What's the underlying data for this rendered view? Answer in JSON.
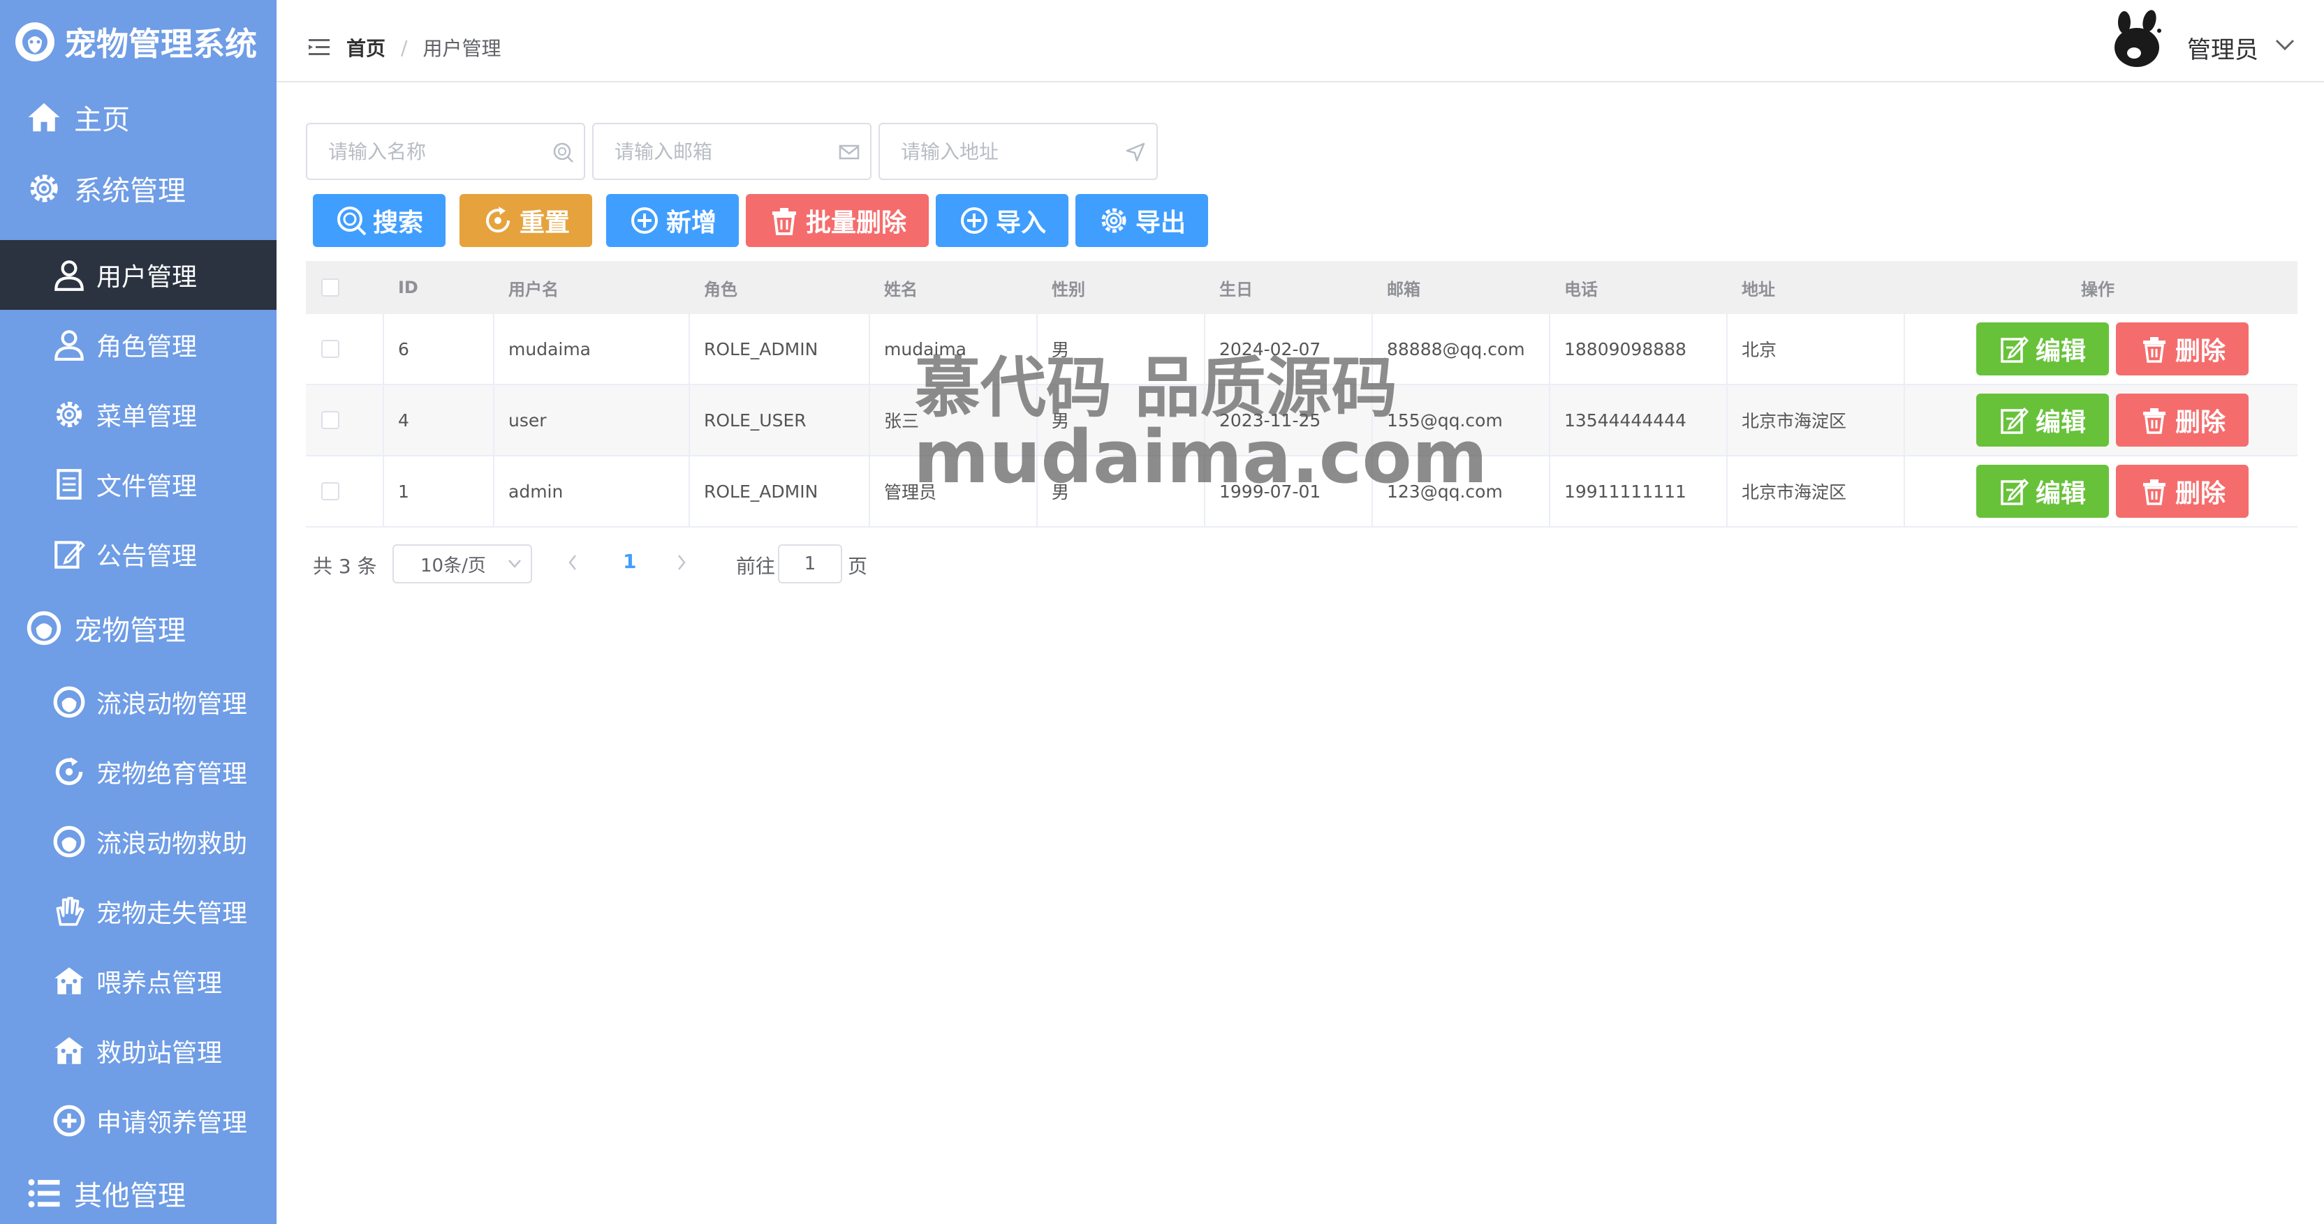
{
  "app": {
    "title": "宠物管理系统"
  },
  "sidebar": {
    "items": [
      {
        "label": "主页",
        "icon": "home-icon"
      },
      {
        "label": "系统管理",
        "icon": "gear-icon"
      },
      {
        "label": "用户管理",
        "icon": "user-icon",
        "active": true
      },
      {
        "label": "角色管理",
        "icon": "user-icon"
      },
      {
        "label": "菜单管理",
        "icon": "gear-icon"
      },
      {
        "label": "文件管理",
        "icon": "document-icon"
      },
      {
        "label": "公告管理",
        "icon": "edit-icon"
      },
      {
        "label": "宠物管理",
        "icon": "pet-icon"
      },
      {
        "label": "流浪动物管理",
        "icon": "pet-icon"
      },
      {
        "label": "宠物绝育管理",
        "icon": "refresh-icon"
      },
      {
        "label": "流浪动物救助",
        "icon": "pet-icon"
      },
      {
        "label": "宠物走失管理",
        "icon": "hand-icon"
      },
      {
        "label": "喂养点管理",
        "icon": "house-icon"
      },
      {
        "label": "救助站管理",
        "icon": "house-icon"
      },
      {
        "label": "申请领养管理",
        "icon": "plus-circle-icon"
      },
      {
        "label": "其他管理",
        "icon": "list-icon"
      }
    ]
  },
  "header": {
    "breadcrumb": {
      "home": "首页",
      "separator": "/",
      "current": "用户管理"
    },
    "user_name": "管理员"
  },
  "search": {
    "name_placeholder": "请输入名称",
    "email_placeholder": "请输入邮箱",
    "address_placeholder": "请输入地址"
  },
  "toolbar": {
    "search_label": "搜索",
    "reset_label": "重置",
    "add_label": "新增",
    "batch_delete_label": "批量删除",
    "import_label": "导入",
    "export_label": "导出"
  },
  "table": {
    "columns": [
      "ID",
      "用户名",
      "角色",
      "姓名",
      "性别",
      "生日",
      "邮箱",
      "电话",
      "地址",
      "操作"
    ],
    "rows": [
      {
        "id": "6",
        "username": "mudaima",
        "role": "ROLE_ADMIN",
        "name": "mudaima",
        "gender": "男",
        "birthday": "2024-02-07",
        "email": "88888@qq.com",
        "phone": "18809098888",
        "address": "北京"
      },
      {
        "id": "4",
        "username": "user",
        "role": "ROLE_USER",
        "name": "张三",
        "gender": "男",
        "birthday": "2023-11-25",
        "email": "155@qq.com",
        "phone": "13544444444",
        "address": "北京市海淀区"
      },
      {
        "id": "1",
        "username": "admin",
        "role": "ROLE_ADMIN",
        "name": "管理员",
        "gender": "男",
        "birthday": "1999-07-01",
        "email": "123@qq.com",
        "phone": "19911111111",
        "address": "北京市海淀区"
      }
    ],
    "edit_label": "编辑",
    "delete_label": "删除"
  },
  "pagination": {
    "total_text": "共 3 条",
    "page_size": "10条/页",
    "current_page": "1",
    "goto_label": "前往",
    "goto_value": "1",
    "page_suffix": "页"
  },
  "watermark": {
    "line1": "慕代码 品质源码",
    "line2": "mudaima.com"
  },
  "colors": {
    "sidebar_bg": "#6f9de6",
    "sidebar_active": "#2b3340",
    "primary": "#409eff",
    "warning": "#e6a23c",
    "danger": "#f56c6c",
    "success": "#67c23a"
  }
}
